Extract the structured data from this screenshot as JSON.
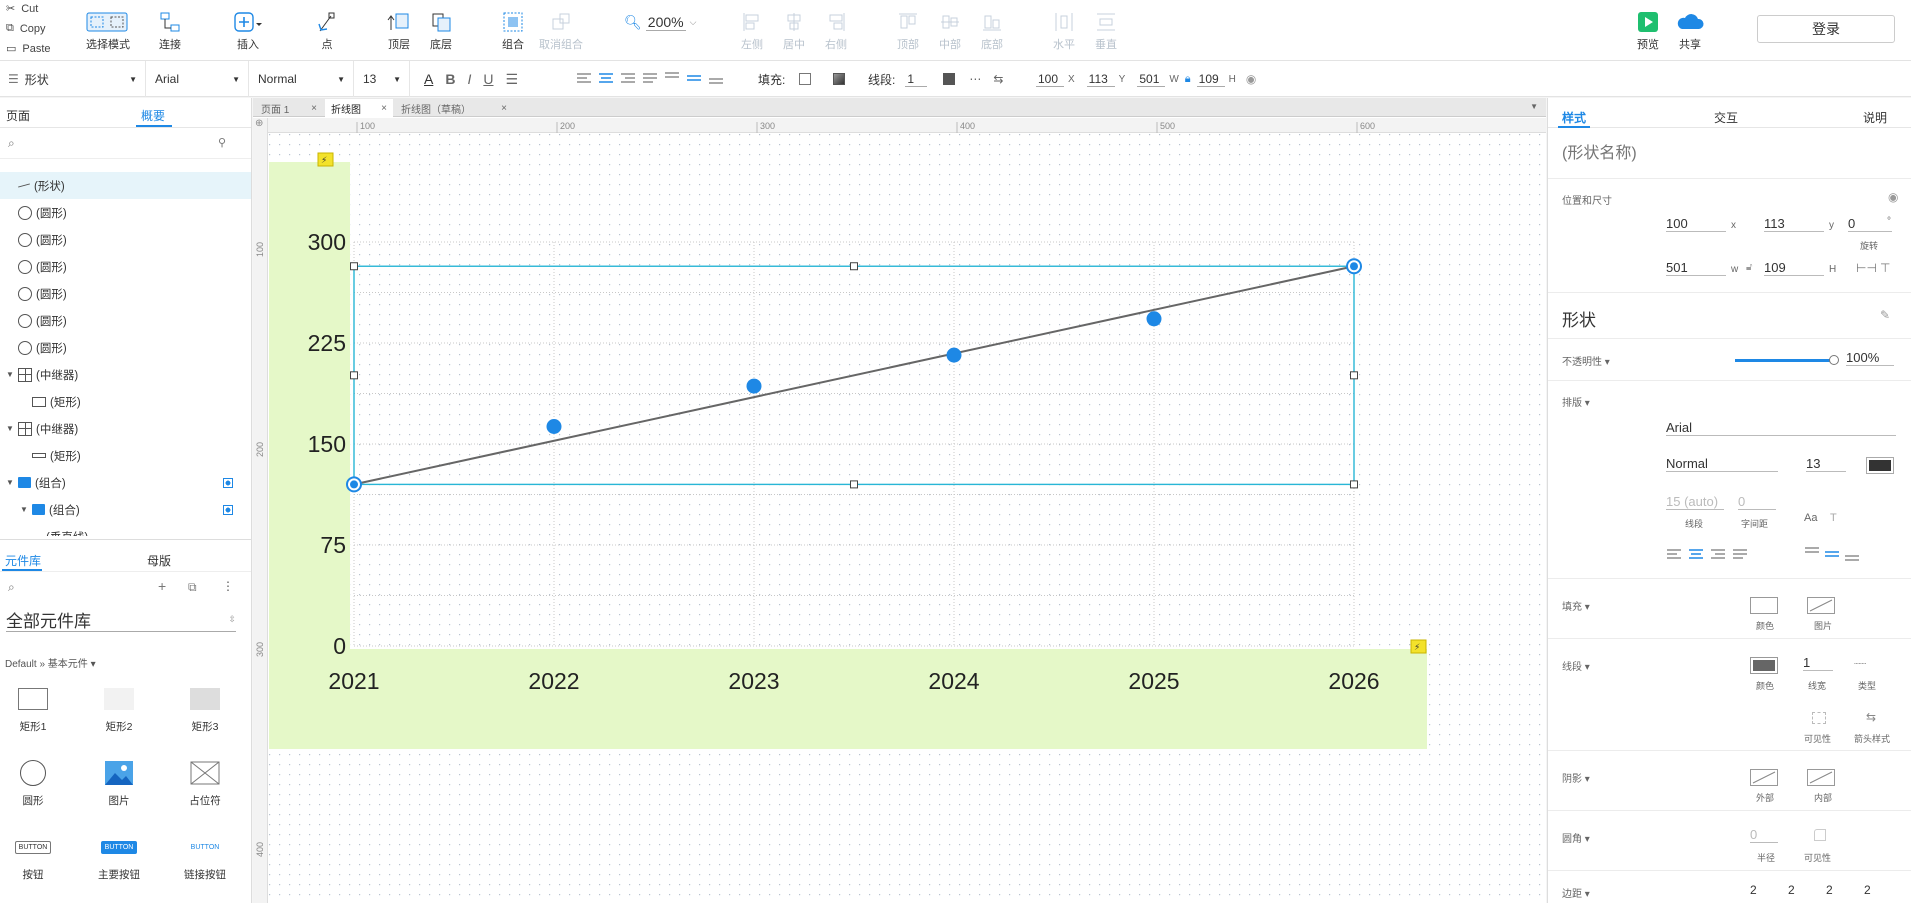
{
  "clipboard": {
    "cut": "Cut",
    "copy": "Copy",
    "paste": "Paste"
  },
  "toolbar": {
    "select_mode": "选择模式",
    "connect": "连接",
    "insert": "插入",
    "point": "点",
    "top_layer": "顶层",
    "bottom_layer": "底层",
    "group": "组合",
    "ungroup": "取消组合",
    "zoom": "200%",
    "align_left": "左侧",
    "align_center": "居中",
    "align_right": "右侧",
    "align_top": "顶部",
    "align_middle": "中部",
    "align_bottom": "底部",
    "dist_horizontal": "水平",
    "dist_vertical": "垂直",
    "preview": "预览",
    "share": "共享",
    "login": "登录"
  },
  "format": {
    "style_name": "形状",
    "font": "Arial",
    "weight": "Normal",
    "size": "13",
    "fill_label": "填充:",
    "stroke_label": "线段:",
    "stroke_width": "1",
    "x": "100",
    "x_label": "X",
    "y": "113",
    "y_label": "Y",
    "w": "501",
    "w_label": "W",
    "h": "109",
    "h_label": "H"
  },
  "left": {
    "tab_pages": "页面",
    "tab_outline": "概要",
    "tree": [
      {
        "label": "(形状)",
        "icon": "line",
        "indent": 0,
        "selected": true
      },
      {
        "label": "(圆形)",
        "icon": "circle",
        "indent": 0
      },
      {
        "label": "(圆形)",
        "icon": "circle",
        "indent": 0
      },
      {
        "label": "(圆形)",
        "icon": "circle",
        "indent": 0
      },
      {
        "label": "(圆形)",
        "icon": "circle",
        "indent": 0
      },
      {
        "label": "(圆形)",
        "icon": "circle",
        "indent": 0
      },
      {
        "label": "(圆形)",
        "icon": "circle",
        "indent": 0
      },
      {
        "label": "(中继器)",
        "icon": "repeater",
        "indent": 0,
        "caret": true
      },
      {
        "label": "(矩形)",
        "icon": "rect",
        "indent": 1
      },
      {
        "label": "(中继器)",
        "icon": "repeater",
        "indent": 0,
        "caret": true
      },
      {
        "label": "(矩形)",
        "icon": "thinrect",
        "indent": 1
      },
      {
        "label": "(组合)",
        "icon": "folder",
        "indent": 0,
        "caret": true,
        "marker": true
      },
      {
        "label": "(组合)",
        "icon": "folder",
        "indent": 1,
        "caret": true,
        "marker": true
      },
      {
        "label": "(垂直线)",
        "icon": "none",
        "indent": 2
      }
    ],
    "lib_tab": "元件库",
    "master_tab": "母版",
    "lib_title": "全部元件库",
    "lib_path": "Default » 基本元件 ▾",
    "lib_items": [
      "矩形1",
      "矩形2",
      "矩形3",
      "圆形",
      "图片",
      "占位符",
      "按钮",
      "主要按钮",
      "链接按钮"
    ],
    "button_text": "BUTTON"
  },
  "tabs": [
    {
      "label": "页面 1",
      "active": false
    },
    {
      "label": "折线图",
      "active": true
    },
    {
      "label": "折线图（草稿）",
      "active": false
    }
  ],
  "ruler": {
    "h": [
      "100",
      "200",
      "300",
      "400",
      "500",
      "600"
    ],
    "v": [
      "100",
      "200",
      "300",
      "400"
    ]
  },
  "chart_data": {
    "type": "line",
    "x": [
      "2021",
      "2022",
      "2023",
      "2024",
      "2025",
      "2026"
    ],
    "series": [
      {
        "values": [
          120,
          163,
          193,
          216,
          243,
          282
        ]
      }
    ],
    "yticks": [
      "300",
      "225",
      "150",
      "75",
      "0"
    ],
    "ylim": [
      0,
      300
    ],
    "grid": true,
    "line_color": "#666666",
    "point_color": "#1e88e5",
    "axis_bg": "#e5f8c8"
  },
  "right": {
    "tab_style": "样式",
    "tab_interact": "交互",
    "tab_notes": "说明",
    "shape_name_placeholder": "(形状名称)",
    "pos_size": "位置和尺寸",
    "x": "100",
    "x_l": "x",
    "y": "113",
    "y_l": "y",
    "rot": "0",
    "rot_unit": "°",
    "rot_l": "旋转",
    "w": "501",
    "w_l": "w",
    "h": "109",
    "h_l": "H",
    "shape_title": "形状",
    "opacity_label": "不透明性 ▾",
    "opacity": "100%",
    "typo_label": "排版 ▾",
    "font": "Arial",
    "weight": "Normal",
    "size": "13",
    "line_spacing": "15 (auto)",
    "line_spacing_l": "线段",
    "char_spacing": "0",
    "char_spacing_l": "字间距",
    "fill_label": "填充 ▾",
    "fill_color_l": "颜色",
    "fill_image_l": "图片",
    "stroke_label": "线段 ▾",
    "stroke_color_l": "颜色",
    "stroke_width": "1",
    "stroke_width_l": "线宽",
    "stroke_type_l": "类型",
    "visibility_l": "可见性",
    "arrow_l": "箭头样式",
    "shadow_label": "阴影 ▾",
    "shadow_outer": "外部",
    "shadow_inner": "内部",
    "corner_label": "圆角 ▾",
    "radius": "0",
    "radius_l": "半径",
    "corner_vis_l": "可见性",
    "padding_label": "边距 ▾",
    "padding": [
      "2",
      "2",
      "2",
      "2"
    ]
  },
  "colors": {
    "accent": "#1e88e5",
    "selection": "#29b6d6",
    "preview": "#1fbf6f"
  }
}
